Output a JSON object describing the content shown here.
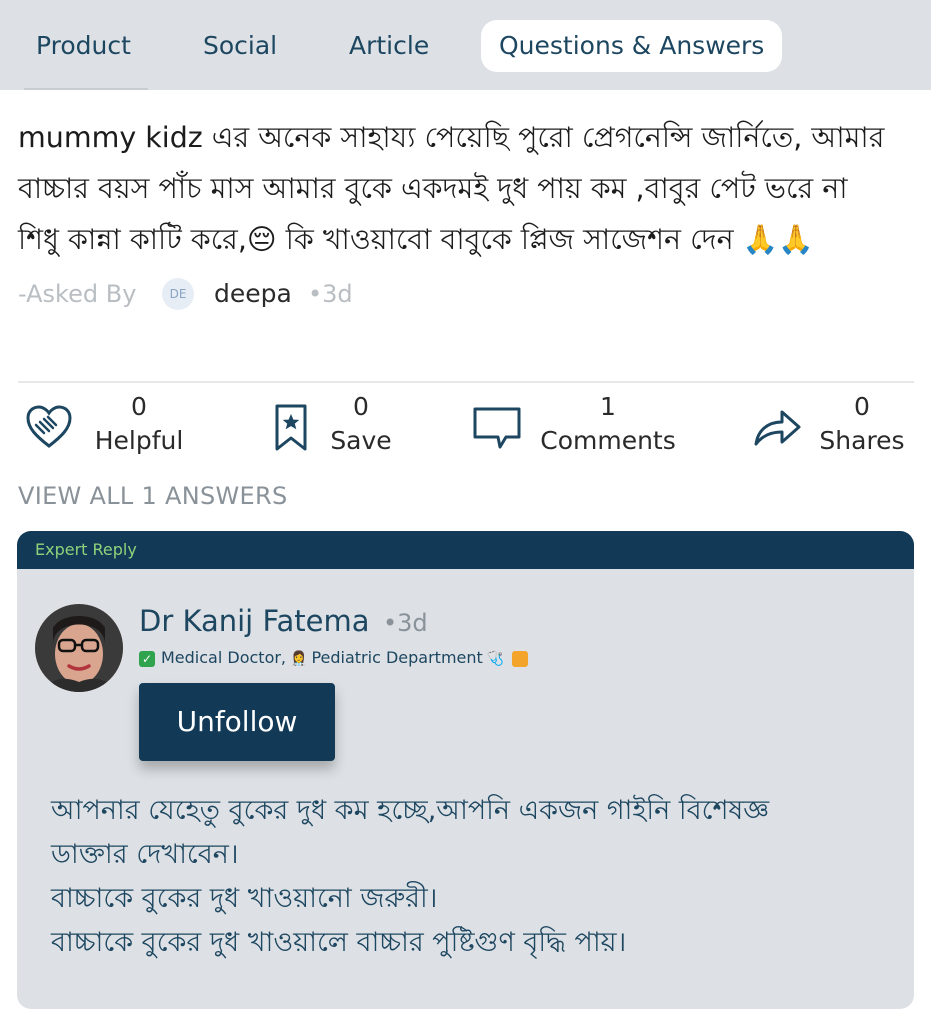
{
  "tabs": [
    {
      "label": "Product",
      "active": false
    },
    {
      "label": "Social",
      "active": false
    },
    {
      "label": "Article",
      "active": false
    },
    {
      "label": "Questions & Answers",
      "active": true
    }
  ],
  "question": {
    "lines": [
      "mummy kidz এর অনেক সাহায্য পেয়েছি পুরো প্রেগনেন্সি জার্নিতে, আমার",
      "বাচ্চার বয়স পাঁচ মাস আমার বুকে একদমই দুধ পায় কম ,বাবুর পেট ভরে না",
      "শিধু কান্না কাটি করে,😔 কি খাওয়াবো বাবুকে প্লিজ সাজেশন দেন 🙏🙏"
    ],
    "asked_by_label": "-Asked By",
    "asker_initials": "DE",
    "asker_name": "deepa",
    "time": "•3d"
  },
  "actions": {
    "helpful": {
      "count": "0",
      "label": "Helpful"
    },
    "save": {
      "count": "0",
      "label": "Save"
    },
    "comments": {
      "count": "1",
      "label": "Comments"
    },
    "shares": {
      "count": "0",
      "label": "Shares"
    }
  },
  "view_all": "VIEW ALL 1 ANSWERS",
  "reply": {
    "badge": "Expert Reply",
    "author": "Dr Kanij Fatema",
    "time": "•3d",
    "role_prefix": "Medical Doctor,",
    "department": "Pediatric Department",
    "follow_button": "Unfollow",
    "lines": [
      "আপনার যেহেতু বুকের দুধ কম হচ্ছে,আপনি একজন গাইনি বিশেষজ্ঞ",
      "ডাক্তার দেখাবেন।",
      "বাচ্চাকে বুকের দুধ খাওয়ানো জরুরী।",
      "বাচ্চাকে বুকের দুধ খাওয়ালে বাচ্চার পুষ্টিগুণ বৃদ্ধি পায়।"
    ]
  },
  "colors": {
    "brand": "#123a57",
    "tab_bar": "#dde1e5",
    "expert_green": "#8fd27a"
  },
  "icons": {
    "helpful": "handshake-heart-icon",
    "save": "bookmark-star-icon",
    "comments": "speech-bubble-icon",
    "shares": "share-arrow-icon"
  }
}
